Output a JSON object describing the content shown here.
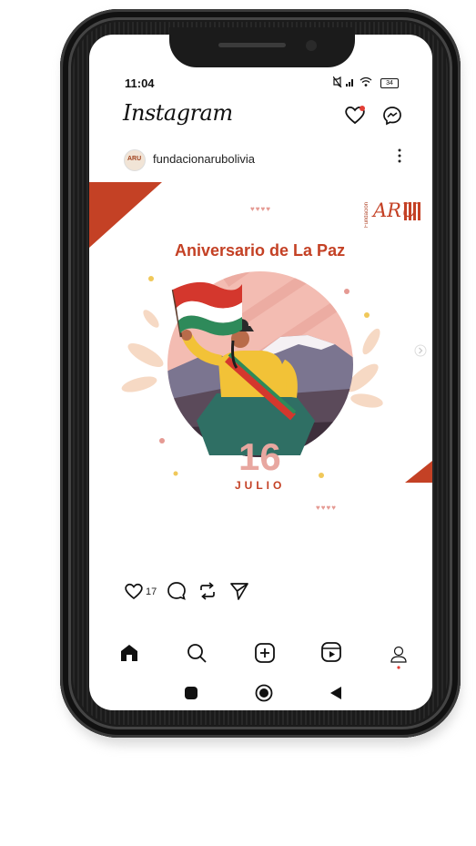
{
  "status": {
    "time": "11:04",
    "battery": "34"
  },
  "app": {
    "logo": "Instagram"
  },
  "post": {
    "username": "fundacionarubolivia",
    "avatar_text": "ARU",
    "title": "Aniversario de La Paz",
    "day": "16",
    "month": "JULIO",
    "brand_name": "ARU",
    "brand_word": "Fundación",
    "likes": "17"
  },
  "icons": {
    "header": [
      "heart-icon",
      "messenger-icon"
    ],
    "actions": [
      "like-icon",
      "comment-icon",
      "repost-icon",
      "share-icon"
    ],
    "tabbar": [
      "home-icon",
      "search-icon",
      "create-icon",
      "reels-icon",
      "profile-icon"
    ],
    "system": [
      "recent-apps-icon",
      "home-nav-icon",
      "back-icon"
    ]
  },
  "colors": {
    "accent": "#c44125",
    "flag_red": "#d4372d",
    "flag_green": "#2e8a5a"
  }
}
